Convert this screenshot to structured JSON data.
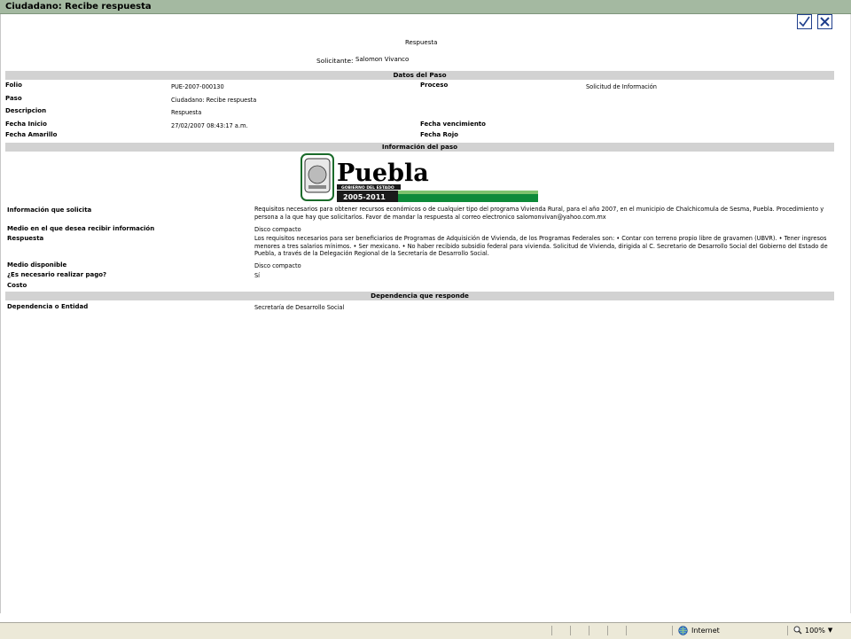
{
  "window": {
    "title": "Ciudadano: Recibe respuesta"
  },
  "toolbar": {
    "accept_icon": "checkmark-icon",
    "cancel_icon": "close-x-icon"
  },
  "header": {
    "respuesta_label": "Respuesta",
    "solicitante_label": "Solicitante:",
    "solicitante_value": "Salomon Vivanco"
  },
  "datos_paso": {
    "heading": "Datos del Paso",
    "folio_label": "Folio",
    "folio_value": "PUE-2007-000130",
    "proceso_label": "Proceso",
    "proceso_value": "Solicitud de Información",
    "paso_label": "Paso",
    "paso_value": "Ciudadano: Recibe respuesta",
    "descripcion_label": "Descripcion",
    "descripcion_value": "Respuesta",
    "fecha_inicio_label": "Fecha Inicio",
    "fecha_inicio_value": "27/02/2007 08:43:17 a.m.",
    "fecha_vencimiento_label": "Fecha vencimiento",
    "fecha_amarillo_label": "Fecha Amarillo",
    "fecha_rojo_label": "Fecha Rojo"
  },
  "informacion_paso": {
    "heading": "Información del paso",
    "logo": {
      "name": "Puebla",
      "subtitle": "GOBIERNO DEL ESTADO",
      "years": "2005-2011"
    },
    "info_solicita_label": "Información que solicita",
    "info_solicita_value": "Requisitos necesarios para obtener recursos económicos o de cualquier tipo del programa Vivienda Rural, para el año 2007, en el municipio de Chalchicomula de Sesma, Puebla. Procedimiento y persona a la que hay que solicitarlos. Favor de mandar la respuesta al correo electronico salomonvivan@yahoo.com.mx",
    "medio_recibir_label": "Medio en el que desea recibir información",
    "medio_recibir_value": "Disco compacto",
    "respuesta_label": "Respuesta",
    "respuesta_value": "Los requisitos necesarios para ser beneficiarios de Programas de Adquisición de Vivienda, de los Programas Federales son: • Contar con terreno propio libre de gravamen (UBVR). • Tener ingresos menores a tres salarios mínimos. • Ser mexicano. • No haber recibido subsidio federal para vivienda. Solicitud de Vivienda, dirigida al C. Secretario de Desarrollo Social del Gobierno del Estado de Puebla, a través de la Delegación Regional de la Secretaría de Desarrollo Social.",
    "medio_disponible_label": "Medio disponible",
    "medio_disponible_value": "Disco compacto",
    "pago_label": "¿Es necesario realizar pago?",
    "pago_value": "Sí",
    "costo_label": "Costo"
  },
  "dependencia": {
    "heading": "Dependencia que responde",
    "entidad_label": "Dependencia o Entidad",
    "entidad_value": "Secretaría de Desarrollo Social"
  },
  "statusbar": {
    "zone": "Internet",
    "zoom": "100%"
  }
}
